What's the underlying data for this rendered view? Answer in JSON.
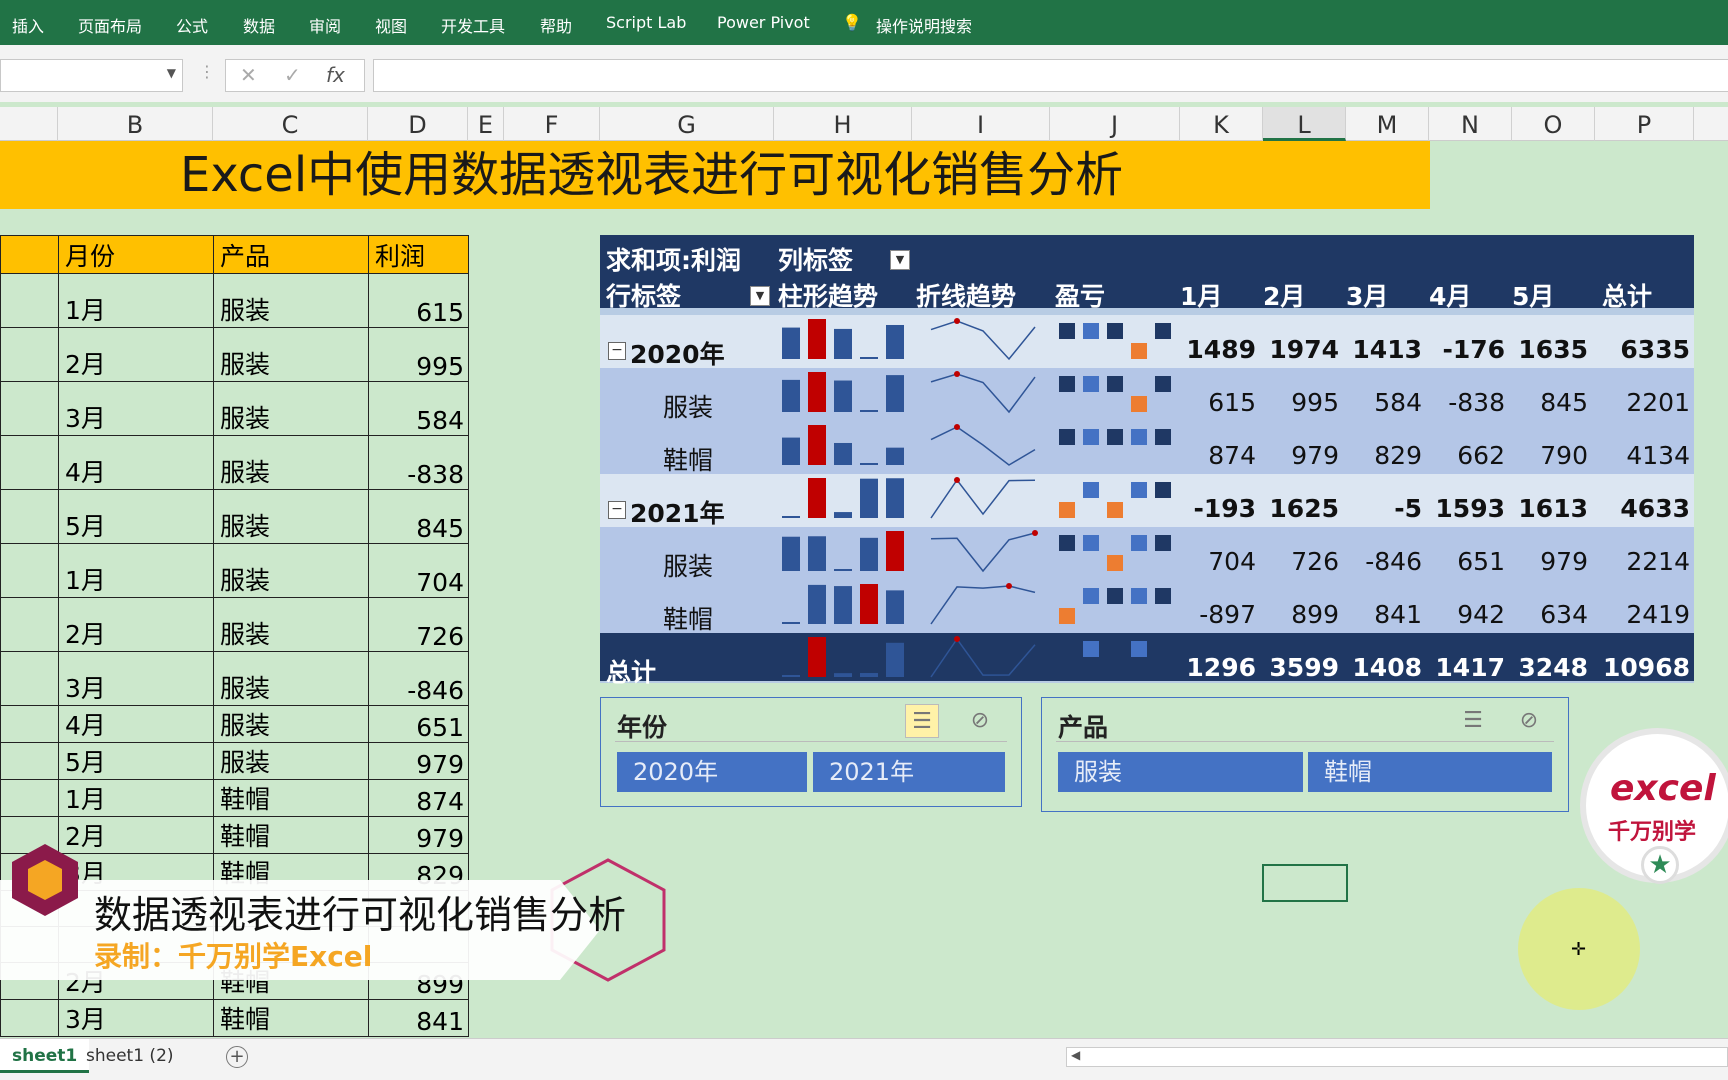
{
  "ribbon": {
    "tabs": [
      "插入",
      "页面布局",
      "公式",
      "数据",
      "审阅",
      "视图",
      "开发工具",
      "帮助",
      "Script Lab",
      "Power Pivot",
      "操作说明搜索"
    ]
  },
  "formula_bar": {
    "fx": "fx",
    "cancel": "✕",
    "enter": "✓"
  },
  "columns": [
    "B",
    "C",
    "D",
    "E",
    "F",
    "G",
    "H",
    "I",
    "J",
    "K",
    "L",
    "M",
    "N",
    "O",
    "P"
  ],
  "title": "Excel中使用数据透视表进行可视化销售分析",
  "table": {
    "headers": [
      "月份",
      "产品",
      "利润"
    ],
    "rows": [
      [
        "1月",
        "服装",
        "615"
      ],
      [
        "2月",
        "服装",
        "995"
      ],
      [
        "3月",
        "服装",
        "584"
      ],
      [
        "4月",
        "服装",
        "-838"
      ],
      [
        "5月",
        "服装",
        "845"
      ],
      [
        "1月",
        "服装",
        "704"
      ],
      [
        "2月",
        "服装",
        "726"
      ],
      [
        "3月",
        "服装",
        "-846"
      ],
      [
        "4月",
        "服装",
        "651"
      ],
      [
        "5月",
        "服装",
        "979"
      ],
      [
        "1月",
        "鞋帽",
        "874"
      ],
      [
        "2月",
        "鞋帽",
        "979"
      ],
      [
        "3月",
        "鞋帽",
        "829"
      ],
      [
        "",
        "",
        ""
      ],
      [
        "",
        "",
        ""
      ],
      [
        "2月",
        "鞋帽",
        "899"
      ],
      [
        "3月",
        "鞋帽",
        "841"
      ]
    ]
  },
  "pivot": {
    "corner": "求和项:利润",
    "col_label": "列标签",
    "row_label": "行标签",
    "spark_headers": [
      "柱形趋势",
      "折线趋势",
      "盈亏"
    ],
    "months": [
      "1月",
      "2月",
      "3月",
      "4月",
      "5月",
      "总计"
    ],
    "rows": [
      {
        "label": "2020年",
        "type": "year",
        "values": [
          "1489",
          "1974",
          "1413",
          "-176",
          "1635",
          "6335"
        ]
      },
      {
        "label": "服装",
        "type": "sub",
        "values": [
          "615",
          "995",
          "584",
          "-838",
          "845",
          "2201"
        ]
      },
      {
        "label": "鞋帽",
        "type": "sub",
        "values": [
          "874",
          "979",
          "829",
          "662",
          "790",
          "4134"
        ]
      },
      {
        "label": "2021年",
        "type": "year",
        "values": [
          "-193",
          "1625",
          "-5",
          "1593",
          "1613",
          "4633"
        ]
      },
      {
        "label": "服装",
        "type": "sub",
        "values": [
          "704",
          "726",
          "-846",
          "651",
          "979",
          "2214"
        ]
      },
      {
        "label": "鞋帽",
        "type": "sub",
        "values": [
          "-897",
          "899",
          "841",
          "942",
          "634",
          "2419"
        ]
      },
      {
        "label": "总计",
        "type": "total",
        "values": [
          "1296",
          "3599",
          "1408",
          "1417",
          "3248",
          "10968"
        ]
      }
    ],
    "colors": {
      "bar": "#2f5597",
      "bar_high": "#c00000",
      "marker": "#c00000",
      "neg": "#ed7d31",
      "pos_dark": "#1f3864",
      "pos_light": "#4472c4"
    }
  },
  "slicers": [
    {
      "title": "年份",
      "items": [
        "2020年",
        "2021年"
      ]
    },
    {
      "title": "产品",
      "items": [
        "服装",
        "鞋帽"
      ]
    }
  ],
  "logo": {
    "line1": "excel",
    "line2": "千万别学"
  },
  "banner": {
    "line1": "数据透视表进行可视化销售分析",
    "line2": "录制：千万别学Excel"
  },
  "sheets": [
    "sheet1",
    "sheet1 (2)"
  ]
}
